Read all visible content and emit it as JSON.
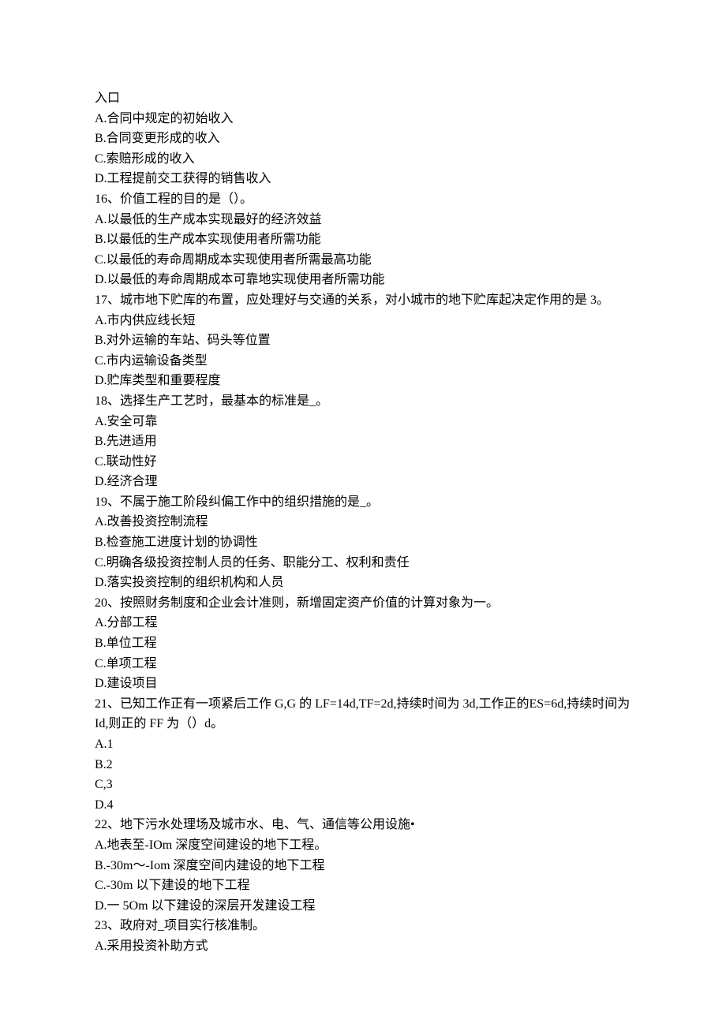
{
  "lines": [
    "入口",
    "A.合同中规定的初始收入",
    "B.合同变更形成的收入",
    "C.索赔形成的收入",
    "D.工程提前交工获得的销售收入",
    "16、价值工程的目的是（）。",
    "A.以最低的生产成本实现最好的经济效益",
    "B.以最低的生产成本实现使用者所需功能",
    "C.以最低的寿命周期成本实现使用者所需最高功能",
    "D.以最低的寿命周期成本可靠地实现使用者所需功能",
    "17、城市地下贮库的布置，应处理好与交通的关系，对小城市的地下贮库起决定作用的是 3。",
    "A.市内供应线长短",
    "B.对外运输的车站、码头等位置",
    "C.市内运输设备类型",
    "D.贮库类型和重要程度",
    "18、选择生产工艺时，最基本的标准是_。",
    "A.安全可靠",
    "B.先进适用",
    "C.联动性好",
    "D.经济合理",
    "19、不属于施工阶段纠偏工作中的组织措施的是_。",
    "A.改善投资控制流程",
    "B.检查施工进度计划的协调性",
    "C.明确各级投资控制人员的任务、职能分工、权利和责任",
    "D.落实投资控制的组织机构和人员",
    "20、按照财务制度和企业会计准则，新增固定资产价值的计算对象为一。",
    "A.分部工程",
    "B.单位工程",
    "C.单项工程",
    "D.建设项目",
    "21、已知工作正有一项紧后工作 G,G 的 LF=14d,TF=2d,持续时间为 3d,工作正的ES=6d,持续时间为 Id,则正的 FF 为（）d。",
    "A.1",
    "B.2",
    "C,3",
    "D.4",
    "22、地下污水处理场及城市水、电、气、通信等公用设施•",
    "A.地表至-IOm 深度空间建设的地下工程。",
    "B.-30m～-Iom 深度空间内建设的地下工程",
    "C.-30m 以下建设的地下工程",
    "D.一 5Om 以下建设的深层开发建设工程",
    "23、政府对_项目实行核准制。",
    "A.采用投资补助方式"
  ]
}
